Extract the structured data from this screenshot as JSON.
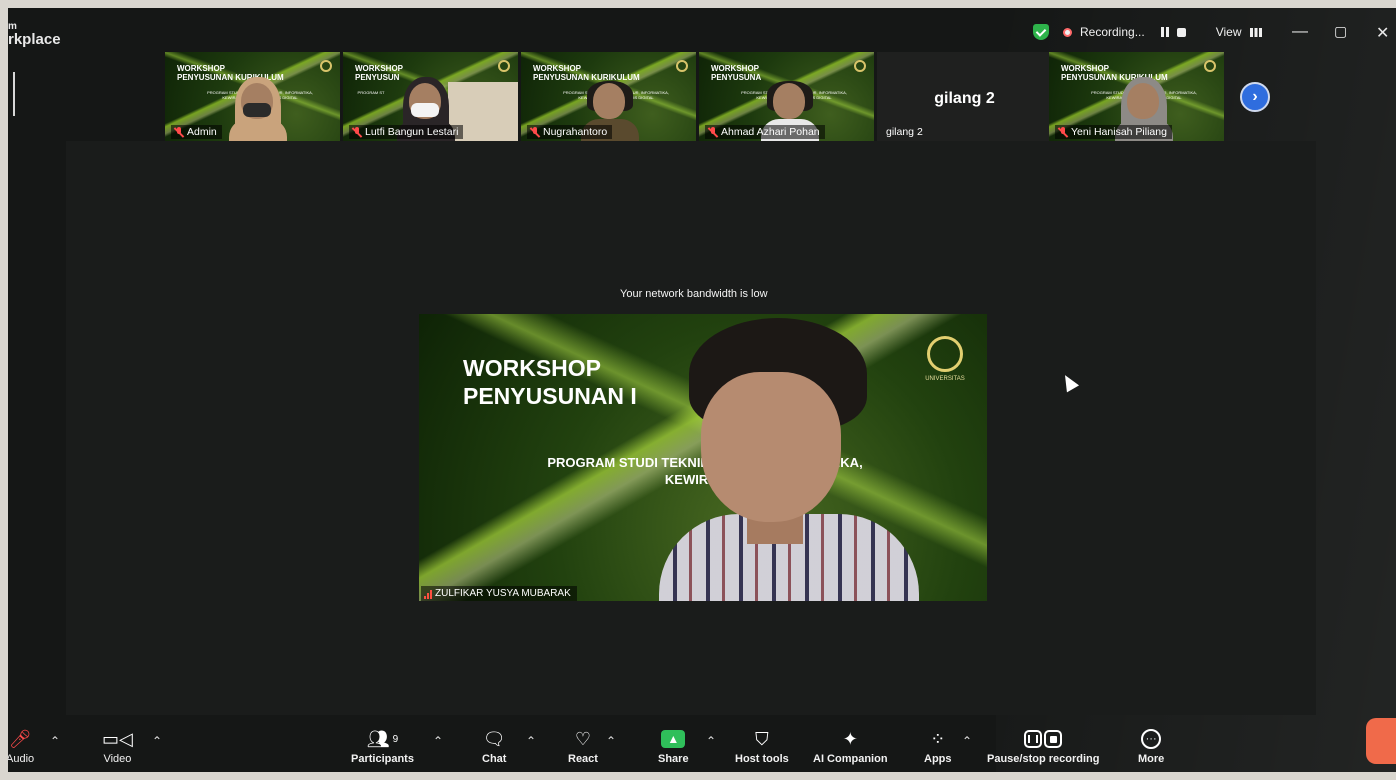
{
  "window": {
    "title_line1": "m",
    "title_line2": "rkplace",
    "recording_label": "Recording...",
    "view_label": "View",
    "minimize": "—",
    "maximize": "▢",
    "close": "✕"
  },
  "thumbnails": [
    {
      "name": "Admin",
      "slide_title": "WORKSHOP\nPENYUSUNAN KURIKULUM",
      "slide_sub": "PROGRAM STUDI TEKNIK ARSITEKTUR, INFORMATIKA, KEWIRAUSAHAAN DAN BISNIS DIGITAL"
    },
    {
      "name": "Lutfi Bangun Lestari",
      "slide_title": "WORKSHOP\nPENYUSUN",
      "slide_sub": "PROGRAM ST"
    },
    {
      "name": "Nugrahantoro",
      "slide_title": "WORKSHOP\nPENYUSUNAN KURIKULUM",
      "slide_sub": "PROGRAM STUDI TEKNIK ARSITEKTUR, INFORMATIKA, KEWIRAUSAHAAN DAN BISNIS DIGITAL"
    },
    {
      "name": "Ahmad Azhari Pohan",
      "slide_title": "WORKSHOP\nPENYUSUNA",
      "slide_sub": "PROGRAM STUDI TEKNIK ARSITEKTUR, INFORMATIKA, KEWIRAUSAHAAN DAN BISNIS DIGITAL"
    },
    {
      "name": "gilang 2",
      "display": "gilang 2"
    },
    {
      "name": "Yeni Hanisah Piliang",
      "slide_title": "WORKSHOP\nPENYUSUNAN KURIKULUM",
      "slide_sub": "PROGRAM STUDI TEKNIK ARSITEKTUR, INFORMATIKA, KEWIRAUSAHAAN DAN BISNIS DIGITAL"
    }
  ],
  "stage": {
    "notice": "Your network bandwidth is low",
    "slide_title": "WORKSHOP\nPENYUSUNAN I",
    "slide_sub": "PROGRAM STUDI TEKNIK                    FORMATIKA,\nKEWIRAUSA",
    "emblem_text": "UNIVERSITAS",
    "speaker_name": "ZULFIKAR YUSYA MUBARAK"
  },
  "toolbar": {
    "audio": "Audio",
    "video": "Video",
    "participants": "Participants",
    "participants_count": "9",
    "chat": "Chat",
    "react": "React",
    "share": "Share",
    "host_tools": "Host tools",
    "ai_companion": "AI Companion",
    "apps": "Apps",
    "pause_stop_recording": "Pause/stop recording",
    "more": "More"
  },
  "colors": {
    "screen_bg": "#151716",
    "stage_bg": "#1a1c1b",
    "share_green": "#2fbf5a",
    "next_blue": "#2f6dde",
    "muted_red": "#ff4a4a",
    "slide_green": "#22420f"
  }
}
